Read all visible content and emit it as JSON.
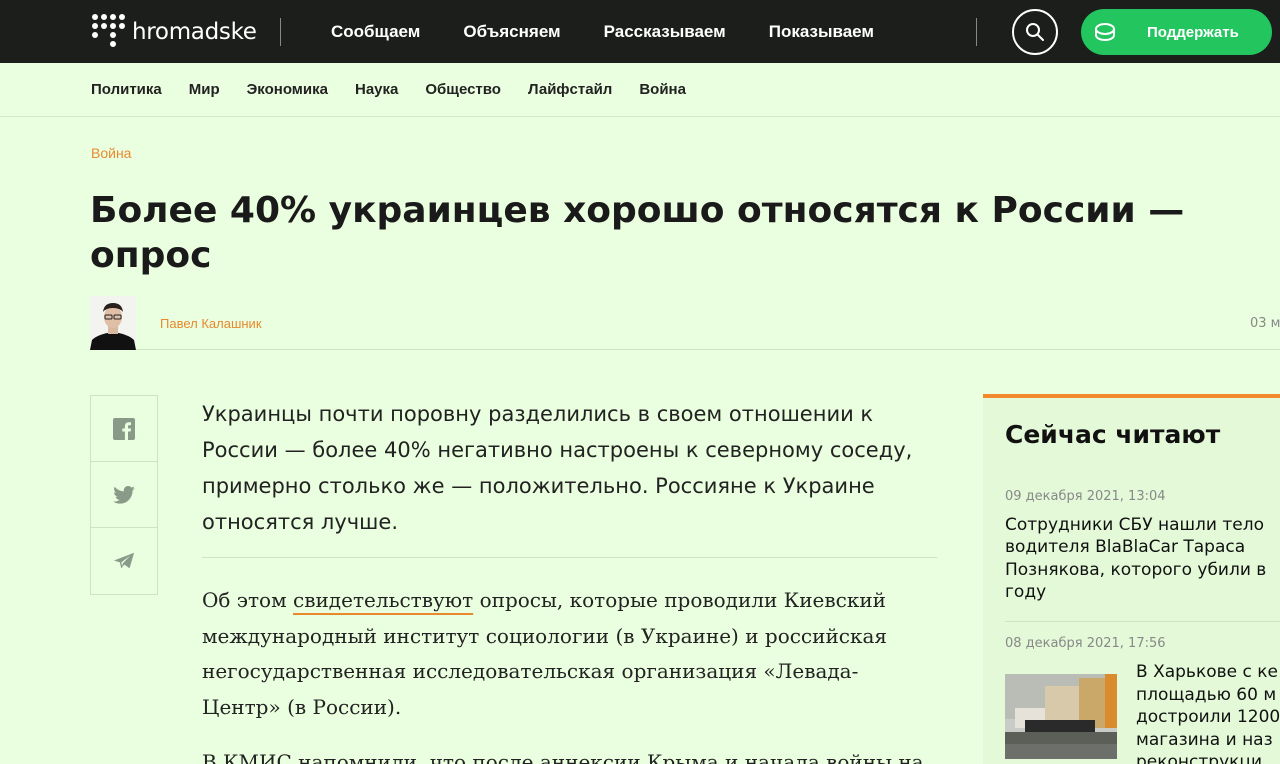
{
  "header": {
    "logo_text": "hromadske",
    "nav": [
      "Сообщаем",
      "Объясняем",
      "Рассказываем",
      "Показываем"
    ],
    "support_label": "Поддержать"
  },
  "subnav": [
    "Политика",
    "Мир",
    "Экономика",
    "Наука",
    "Общество",
    "Лайфстайл",
    "Война"
  ],
  "article": {
    "category": "Война",
    "title_line1": "Более 40% украинцев хорошо относятся к России —",
    "title_line2": "опрос",
    "author": "Павел Калашник",
    "date": "03 м",
    "lead": "Украинцы почти поровну разделились в своем отношении к России — более 40% негативно настроены к северному соседу, примерно столько же — положительно. Россияне к Украине относятся лучше.",
    "p1_before": "Об этом ",
    "p1_link": "свидетельствуют",
    "p1_after": " опросы, которые проводили Киевский международный институт социологии (в Украине) и российская негосударственная исследовательская организация «Левада-Центр» (в России).",
    "p2": "В КМИС напомнили, что после аннексии Крыма и начала войны на"
  },
  "sidebar": {
    "title": "Сейчас читают",
    "items": [
      {
        "date": "09 декабря 2021, 13:04",
        "lines": [
          "Сотрудники СБУ нашли тело",
          "водителя BlaBlaCar Тараса",
          "Познякова, которого убили в",
          "году"
        ]
      },
      {
        "date": "08 декабря 2021, 17:56",
        "lines": [
          "В Харькове с ке",
          "площадью 60 м",
          "достроили 1200",
          "магазина и наз",
          "реконструкци"
        ]
      }
    ]
  },
  "icons": [
    "facebook-icon",
    "twitter-icon",
    "telegram-icon",
    "search-icon",
    "coin-icon"
  ],
  "colors": {
    "accent": "#e8892c",
    "support": "#22c55e",
    "topbar": "#1b1e1a",
    "background": "#eaffdf"
  }
}
